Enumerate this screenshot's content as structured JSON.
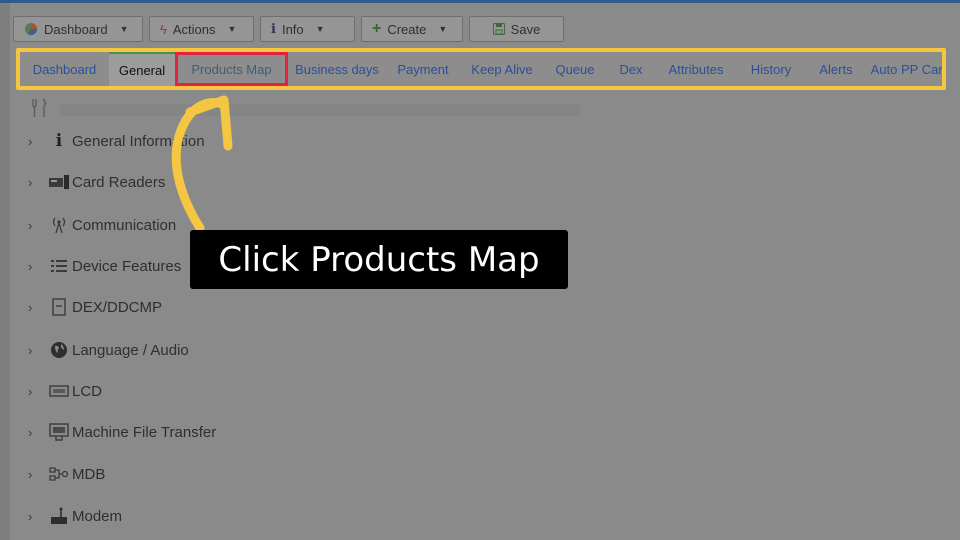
{
  "toolbar": {
    "dashboard": {
      "label": "Dashboard",
      "icon": "pie-chart-icon"
    },
    "actions": {
      "label": "Actions",
      "icon": "bolt-icon"
    },
    "info": {
      "label": "Info",
      "icon": "info-icon"
    },
    "create": {
      "label": "Create",
      "icon": "plus-icon"
    },
    "save": {
      "label": "Save",
      "icon": "floppy-icon"
    }
  },
  "tabs": [
    {
      "label": "Dashboard"
    },
    {
      "label": "General",
      "active": true
    },
    {
      "label": "Products Map",
      "highlighted": true
    },
    {
      "label": "Business days"
    },
    {
      "label": "Payment"
    },
    {
      "label": "Keep Alive"
    },
    {
      "label": "Queue"
    },
    {
      "label": "Dex"
    },
    {
      "label": "Attributes"
    },
    {
      "label": "History"
    },
    {
      "label": "Alerts"
    },
    {
      "label": "Auto PP Cards"
    }
  ],
  "tree": {
    "items": [
      {
        "label": "General Information",
        "icon": "info-icon"
      },
      {
        "label": "Card Readers",
        "icon": "card-reader-icon"
      },
      {
        "label": "Communication",
        "icon": "antenna-icon"
      },
      {
        "label": "Device Features",
        "icon": "features-list-icon"
      },
      {
        "label": "DEX/DDCMP",
        "icon": "dex-icon"
      },
      {
        "label": "Language / Audio",
        "icon": "globe-icon"
      },
      {
        "label": "LCD",
        "icon": "lcd-icon"
      },
      {
        "label": "Machine File Transfer",
        "icon": "ftp-icon"
      },
      {
        "label": "MDB",
        "icon": "mdb-icon"
      },
      {
        "label": "Modem",
        "icon": "modem-icon"
      }
    ]
  },
  "callout": {
    "text": "Click Products Map"
  },
  "colors": {
    "highlight_border": "#f5c642",
    "target_outline": "#e3223d",
    "arrow": "#f5c642",
    "callout_bg": "#000000",
    "active_tab_line": "#3c9a3c"
  }
}
